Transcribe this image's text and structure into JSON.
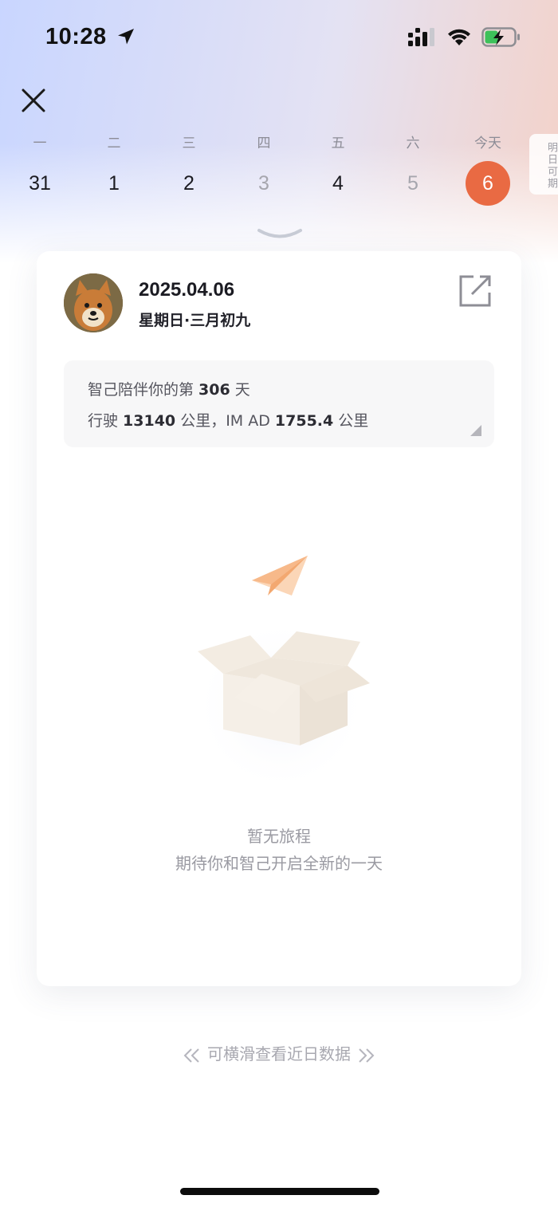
{
  "status_bar": {
    "time": "10:28"
  },
  "week": {
    "days": [
      {
        "label": "一",
        "num": "31",
        "state": "normal"
      },
      {
        "label": "二",
        "num": "1",
        "state": "normal"
      },
      {
        "label": "三",
        "num": "2",
        "state": "normal"
      },
      {
        "label": "四",
        "num": "3",
        "state": "muted"
      },
      {
        "label": "五",
        "num": "4",
        "state": "normal"
      },
      {
        "label": "六",
        "num": "5",
        "state": "muted"
      },
      {
        "label": "今天",
        "num": "6",
        "state": "today"
      }
    ],
    "tomorrow_tab": "明日可期"
  },
  "card": {
    "date": "2025.04.06",
    "date_sub": "星期日·三月初九",
    "stats": {
      "line1_prefix": "智己陪伴你的第 ",
      "days": "306",
      "line1_suffix": " 天",
      "line2_prefix": "行驶 ",
      "distance": "13140",
      "line2_mid": " 公里，IM AD ",
      "ad_distance": "1755.4",
      "line2_suffix": " 公里"
    },
    "empty_title": "暂无旅程",
    "empty_subtitle": "期待你和智己开启全新的一天"
  },
  "swipe_hint": "可横滑查看近日数据",
  "colors": {
    "today_accent": "#e96a43",
    "text_primary": "#1b1b22",
    "text_muted": "#9a9aa2"
  },
  "icons": [
    "location-arrow-icon",
    "cellular-signal-icon",
    "wifi-icon",
    "battery-charging-icon",
    "close-icon",
    "chevron-down-icon",
    "share-external-icon",
    "paper-plane-icon",
    "empty-box-icon",
    "double-chevron-left-icon",
    "double-chevron-right-icon"
  ]
}
